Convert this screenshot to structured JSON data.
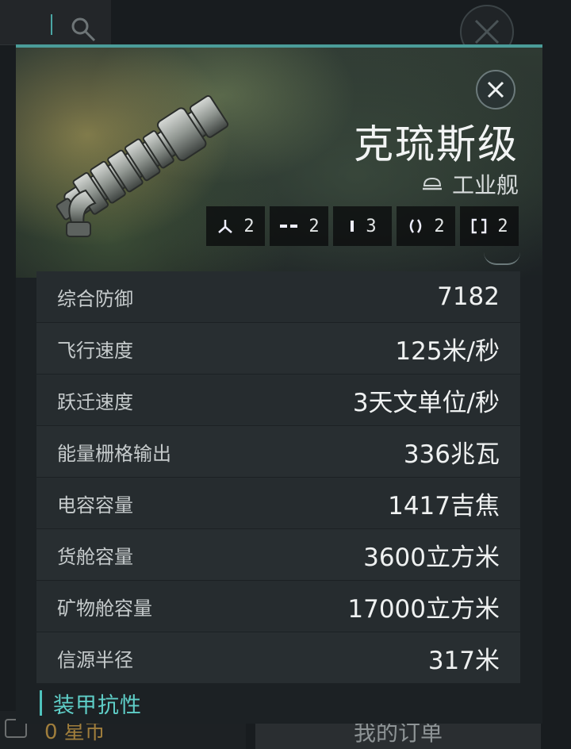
{
  "background": {
    "bottom_bar": {
      "currency": "0 星币",
      "orders_button": "我的订单"
    }
  },
  "ship": {
    "name": "克琉斯级",
    "class_label": "工业舰",
    "slots": [
      {
        "icon": "high-slot-icon",
        "count": "2"
      },
      {
        "icon": "mid-slot-icon",
        "count": "2"
      },
      {
        "icon": "low-slot-icon",
        "count": "3"
      },
      {
        "icon": "rig-slot-icon",
        "count": "2"
      },
      {
        "icon": "drone-slot-icon",
        "count": "2"
      }
    ]
  },
  "stats": [
    {
      "label": "综合防御",
      "value": "7182"
    },
    {
      "label": "飞行速度",
      "value": "125米/秒"
    },
    {
      "label": "跃迁速度",
      "value": "3天文单位/秒"
    },
    {
      "label": "能量栅格输出",
      "value": "336兆瓦"
    },
    {
      "label": "电容容量",
      "value": "1417吉焦"
    },
    {
      "label": "货舱容量",
      "value": "3600立方米"
    },
    {
      "label": "矿物舱容量",
      "value": "17000立方米"
    },
    {
      "label": "信源半径",
      "value": "317米"
    }
  ],
  "section_title": "装甲抗性",
  "colors": {
    "accent": "#4b9c99",
    "section_accent": "#5fcfc8",
    "coin": "#a07e3c"
  }
}
